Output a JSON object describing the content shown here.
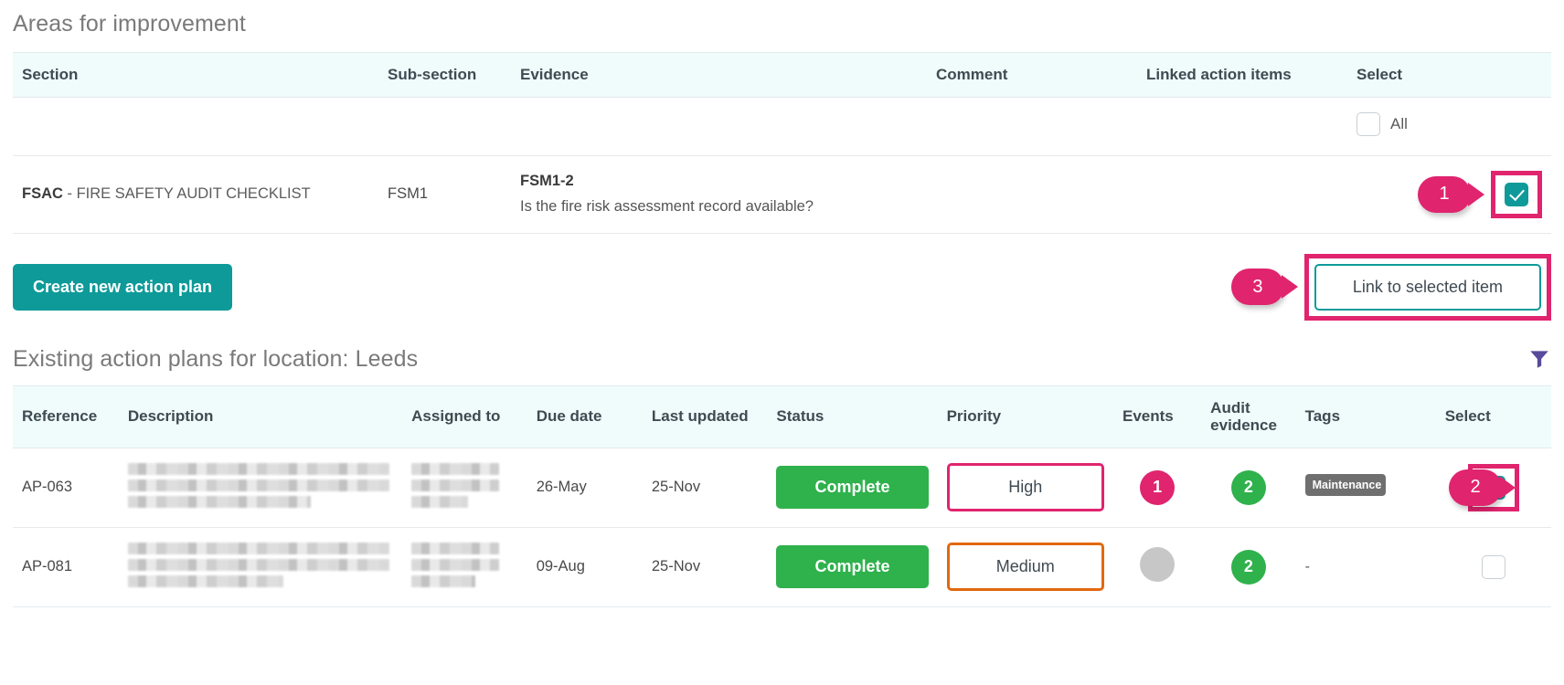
{
  "improvement": {
    "title": "Areas for improvement",
    "columns": [
      "Section",
      "Sub-section",
      "Evidence",
      "Comment",
      "Linked action items",
      "Select"
    ],
    "all_label": "All",
    "all_checked": false,
    "rows": [
      {
        "section_code": "FSAC",
        "section_rest": "- FIRE SAFETY AUDIT CHECKLIST",
        "subsection": "FSM1",
        "evidence_code": "FSM1-2",
        "evidence_text": "Is the fire risk assessment record available?",
        "comment": "",
        "linked": "",
        "selected": true
      }
    ]
  },
  "actions": {
    "create_label": "Create new action plan",
    "link_label": "Link to selected item"
  },
  "existing": {
    "title": "Existing action plans for location: Leeds",
    "filter_icon": "filter-funnel-icon",
    "columns": [
      "Reference",
      "Description",
      "Assigned to",
      "Due date",
      "Last updated",
      "Status",
      "Priority",
      "Events",
      "Audit evidence",
      "Tags",
      "Select"
    ],
    "rows": [
      {
        "reference": "AP-063",
        "description": "",
        "assigned_to": "",
        "due_date": "26-May",
        "last_updated": "25-Nov",
        "status": "Complete",
        "priority": "High",
        "events": "1",
        "audit_evidence": "2",
        "tags": "Maintenance",
        "selected": true
      },
      {
        "reference": "AP-081",
        "description": "",
        "assigned_to": "",
        "due_date": "09-Aug",
        "last_updated": "25-Nov",
        "status": "Complete",
        "priority": "Medium",
        "events": "",
        "audit_evidence": "2",
        "tags": "-",
        "selected": false
      }
    ]
  },
  "annotations": {
    "pin1": "1",
    "pin2": "2",
    "pin3": "3"
  },
  "colors": {
    "teal": "#0d9a99",
    "pink": "#e0246e",
    "green": "#2fb14c",
    "orange": "#e2680f",
    "purple": "#584a9c",
    "header_bg": "#effcfb"
  }
}
